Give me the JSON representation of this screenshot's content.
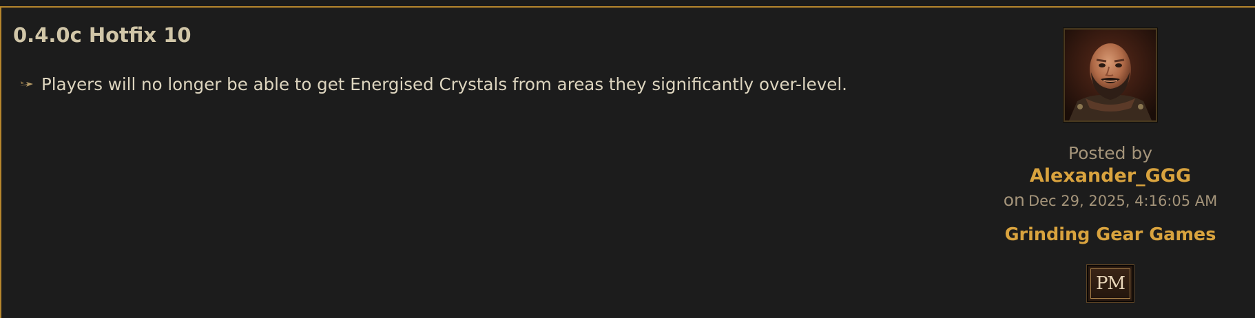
{
  "post": {
    "title": "0.4.0c Hotfix 10",
    "bullets": [
      {
        "icon": "arrow-bullet-icon",
        "text": "Players will no longer be able to get Energised Crystals from areas they significantly over-level."
      }
    ]
  },
  "sidebar": {
    "avatar_icon": "character-portrait-icon",
    "posted_by_label": "Posted by",
    "author": "Alexander_GGG",
    "on_label": "on",
    "date": "Dec 29, 2025, 4:16:05 AM",
    "company": "Grinding Gear Games",
    "pm_label": "PM"
  },
  "colors": {
    "background": "#1c1c1c",
    "border": "#b6862d",
    "title": "#d1c6a8",
    "body_text": "#ddd5bf",
    "muted_text": "#a4947a",
    "accent_link": "#d9a33e"
  }
}
